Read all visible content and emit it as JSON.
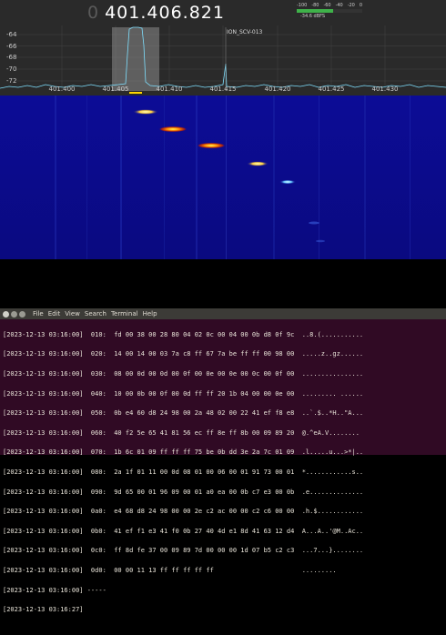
{
  "spectrum": {
    "frequency_prefix": "0",
    "frequency": "401.406.821",
    "y_labels": [
      "-64",
      "-66",
      "-68",
      "-70",
      "-72"
    ],
    "x_labels": [
      "401.400",
      "401.405",
      "401.410",
      "401.415",
      "401.420",
      "401.425",
      "401.430"
    ],
    "marker_label": "ION_SCV-013",
    "meter": {
      "ticks": [
        "-100",
        "-80",
        "-60",
        "-40",
        "-20",
        "0"
      ],
      "value_label": "-34.6 dBFS",
      "level_fraction": 0.55
    }
  },
  "colors": {
    "terminal_bg": "#300a24",
    "waterfall_bg": "#0a0a8c",
    "meter_green": "#3fb24a",
    "titlebar": "#3c3b37"
  },
  "terminal": {
    "menu": [
      "File",
      "Edit",
      "View",
      "Search",
      "Terminal",
      "Help"
    ],
    "lines": [
      "[2023-12-13 03:16:00]  010:  fd 00 38 00 28 80 04 02 0c 00 04 00 0b d8 0f 9c  ..8.(...........",
      "[2023-12-13 03:16:00]  020:  14 00 14 00 03 7a c8 ff 67 7a be ff ff 00 98 00  .....z..gz......",
      "[2023-12-13 03:16:00]  030:  08 00 0d 00 0d 00 0f 00 0e 00 0e 00 0c 00 0f 00  ................",
      "[2023-12-13 03:16:00]  040:  10 00 0b 00 0f 00 0d ff ff 20 1b 04 00 00 0e 00  ......... ......",
      "[2023-12-13 03:16:00]  050:  0b e4 60 d8 24 98 00 2a 48 02 00 22 41 ef f8 e8  ..`.$..*H..\"A...",
      "[2023-12-13 03:16:00]  060:  40 f2 5e 65 41 81 56 ec ff 8e ff 8b 00 09 89 20  @.^eA.V........ ",
      "[2023-12-13 03:16:00]  070:  1b 6c 01 09 ff ff ff 75 be 0b dd 3e 2a 7c 01 09  .l.....u...>*|..",
      "[2023-12-13 03:16:00]  080:  2a 1f 01 11 00 0d 08 01 00 06 00 01 91 73 00 01  *............s..",
      "[2023-12-13 03:16:00]  090:  9d 65 00 01 96 09 00 01 a0 ea 00 0b c7 e3 00 0b  .e..............",
      "[2023-12-13 03:16:00]  0a0:  e4 68 d8 24 98 00 00 2e c2 ac 00 00 c2 c6 00 00  .h.$............",
      "[2023-12-13 03:16:00]  0b0:  41 ef f1 e3 41 f0 0b 27 40 4d e1 8d 41 63 12 d4  A...A..'@M..Ac..",
      "[2023-12-13 03:16:00]  0c0:  ff 8d fe 37 00 09 89 7d 00 00 00 1d 07 b5 c2 c3  ...7...}........",
      "[2023-12-13 03:16:00]  0d0:  00 00 11 13 ff ff ff ff ff                       .........",
      "[2023-12-13 03:16:00] -----",
      "[2023-12-13 03:16:27]"
    ]
  }
}
